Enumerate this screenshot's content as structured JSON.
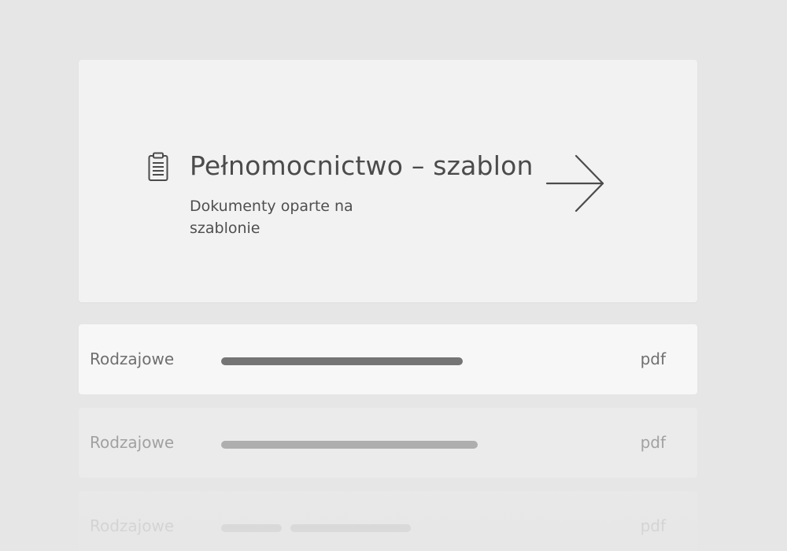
{
  "hero": {
    "icon": "clipboard-icon",
    "title": "Pełnomocnictwo – szablon",
    "subtitle": "Dokumenty oparte na szablonie",
    "action_icon": "arrow-right-icon"
  },
  "documents": [
    {
      "label": "Rodzajowe",
      "extension": "pdf"
    },
    {
      "label": "Rodzajowe",
      "extension": "pdf"
    },
    {
      "label": "Rodzajowe",
      "extension": "pdf"
    }
  ],
  "colors": {
    "background": "#e6e6e6",
    "card": "#f2f2f2",
    "text": "#4b4b4b",
    "muted_text": "#6f6f6f",
    "placeholder_bar": "#757575"
  }
}
